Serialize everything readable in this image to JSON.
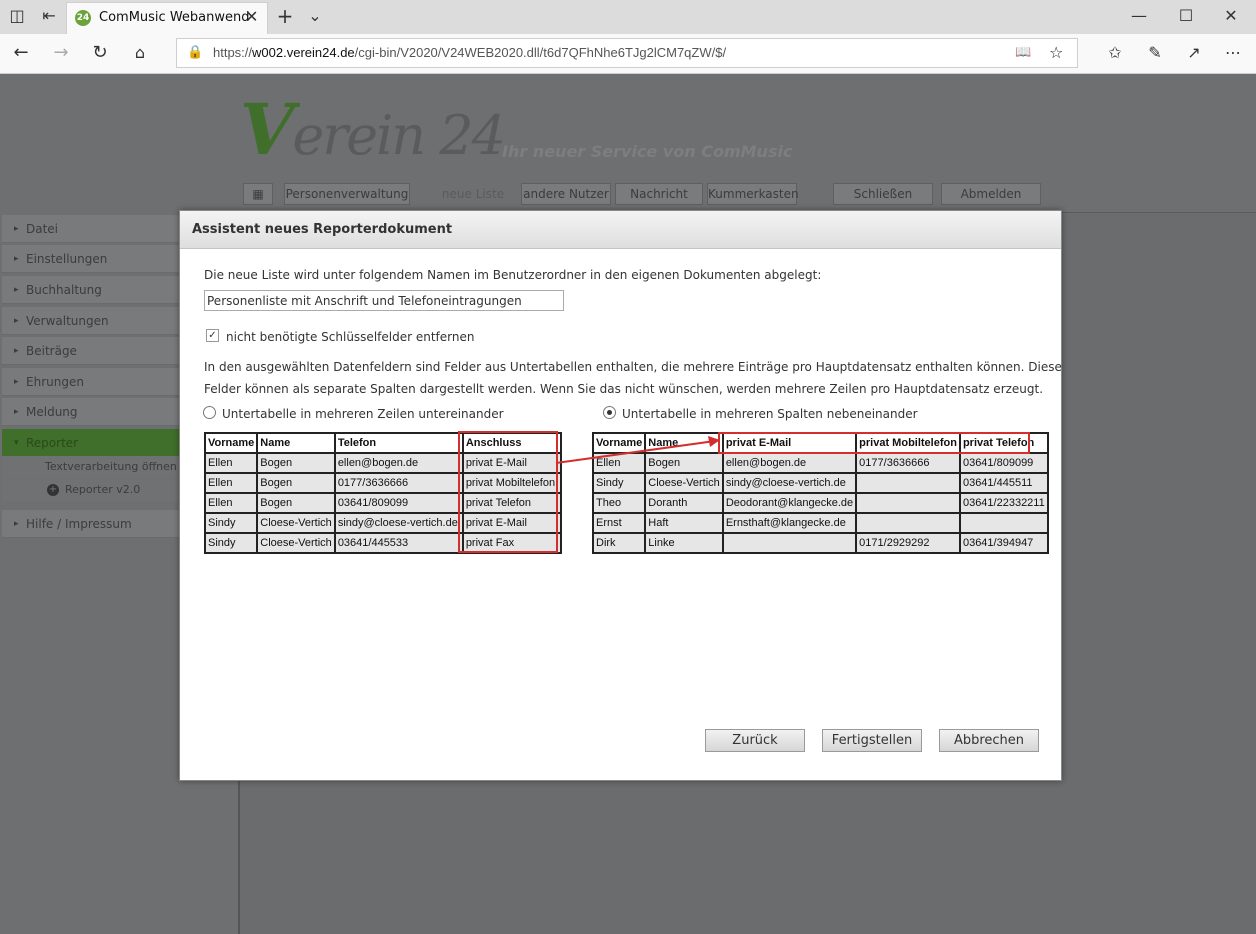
{
  "browser": {
    "tab_title": "ComMusic Webanwend",
    "favicon_text": "24",
    "url_prefix": "https://",
    "url_domain": "w002.verein24.de",
    "url_path": "/cgi-bin/V2020/V24WEB2020.dll/t6d7QFhNhe6TJg2lCM7qZW/$/"
  },
  "header": {
    "logo_v": "V",
    "logo_rest": "erein 24",
    "slogan": "Ihr neuer Service von ComMusic",
    "nav": {
      "personen": "Personenverwaltung",
      "neue_liste": "neue Liste",
      "andere_nutzer": "andere Nutzer",
      "nachricht": "Nachricht",
      "kummerkasten": "Kummerkasten",
      "schliessen": "Schließen",
      "abmelden": "Abmelden"
    }
  },
  "sidebar": {
    "items": [
      {
        "label": "Datei"
      },
      {
        "label": "Einstellungen"
      },
      {
        "label": "Buchhaltung"
      },
      {
        "label": "Verwaltungen"
      },
      {
        "label": "Beiträge"
      },
      {
        "label": "Ehrungen"
      },
      {
        "label": "Meldung"
      },
      {
        "label": "Reporter"
      },
      {
        "label": "Hilfe / Impressum"
      }
    ],
    "sub": {
      "textverarbeitung": "Textverarbeitung öffnen",
      "reporter_v2": "Reporter v2.0"
    }
  },
  "dialog": {
    "title": "Assistent neues Reporterdokument",
    "intro": "Die neue Liste wird unter folgendem Namen im Benutzerordner in den eigenen Dokumenten abgelegt:",
    "name_value": "Personenliste mit Anschrift und Telefoneintragungen",
    "checkbox_label": "nicht benötigte Schlüsselfelder entfernen",
    "info_line1": "In den ausgewählten Datenfeldern sind Felder aus Untertabellen enthalten, die mehrere Einträge pro Hauptdatensatz enthalten können. Diese",
    "info_line2": "Felder können als separate Spalten dargestellt werden. Wenn Sie das nicht wünschen, werden mehrere Zeilen pro Hauptdatensatz erzeugt.",
    "radio_rows_label": "Untertabelle in mehreren Zeilen untereinander",
    "radio_cols_label": "Untertabelle in mehreren Spalten nebeneinander",
    "selected_option": "cols",
    "table_left": {
      "headers": [
        "Vorname",
        "Name",
        "Telefon",
        "Anschluss"
      ],
      "rows": [
        [
          "Ellen",
          "Bogen",
          "ellen@bogen.de",
          "privat E-Mail"
        ],
        [
          "Ellen",
          "Bogen",
          "0177/3636666",
          "privat Mobiltelefon"
        ],
        [
          "Ellen",
          "Bogen",
          "03641/809099",
          "privat Telefon"
        ],
        [
          "Sindy",
          "Cloese-Vertich",
          "sindy@cloese-vertich.de",
          "privat E-Mail"
        ],
        [
          "Sindy",
          "Cloese-Vertich",
          "03641/445533",
          "privat Fax"
        ]
      ]
    },
    "table_right": {
      "headers": [
        "Vorname",
        "Name",
        "privat E-Mail",
        "privat Mobiltelefon",
        "privat Telefon"
      ],
      "rows": [
        [
          "Ellen",
          "Bogen",
          "ellen@bogen.de",
          "0177/3636666",
          "03641/809099"
        ],
        [
          "Sindy",
          "Cloese-Vertich",
          "sindy@cloese-vertich.de",
          "",
          "03641/445511"
        ],
        [
          "Theo",
          "Doranth",
          "Deodorant@klangecke.de",
          "",
          "03641/22332211"
        ],
        [
          "Ernst",
          "Haft",
          "Ernsthaft@klangecke.de",
          "",
          ""
        ],
        [
          "Dirk",
          "Linke",
          "",
          "0171/2929292",
          "03641/394947"
        ]
      ]
    },
    "buttons": {
      "back": "Zurück",
      "finish": "Fertigstellen",
      "cancel": "Abbrechen"
    }
  },
  "colors": {
    "accent_green": "#3f6f2a",
    "highlight_red": "#d32f2f",
    "page_gray": "#6e6f71"
  }
}
